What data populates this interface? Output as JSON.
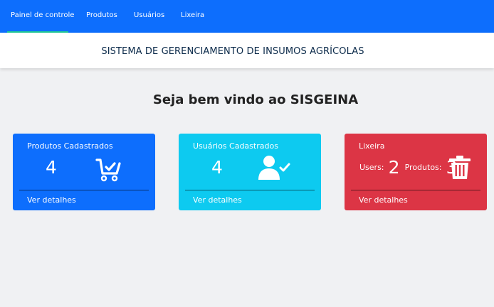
{
  "nav": {
    "items": [
      {
        "label": "Painel de controle",
        "active": true
      },
      {
        "label": "Produtos"
      },
      {
        "label": "Usuários"
      },
      {
        "label": "Lixeira"
      }
    ]
  },
  "header": {
    "title": "SISTEMA DE GERENCIAMENTO DE INSUMOS AGRÍCOLAS"
  },
  "main": {
    "welcome": "Seja bem vindo ao SISGEINA",
    "cards": [
      {
        "title": "Produtos Cadastrados",
        "count": "4",
        "link": "Ver detalhes",
        "icon": "shopping-cart-check-icon",
        "color": "#0d6efd"
      },
      {
        "title": "Usuários Cadastrados",
        "count": "4",
        "link": "Ver detalhes",
        "icon": "user-check-icon",
        "color": "#0dcaf0"
      },
      {
        "title": "Lixeira",
        "users_label": "Users:",
        "users_count": "2",
        "products_label": "Produtos:",
        "products_count": "3",
        "link": "Ver detalhes",
        "icon": "trash-icon",
        "color": "#dc3545"
      }
    ]
  },
  "colors": {
    "navbar": "#0d6efd",
    "active_underline": "#20c997",
    "background": "#f0f1f3",
    "title_text": "#0b2a4a"
  }
}
